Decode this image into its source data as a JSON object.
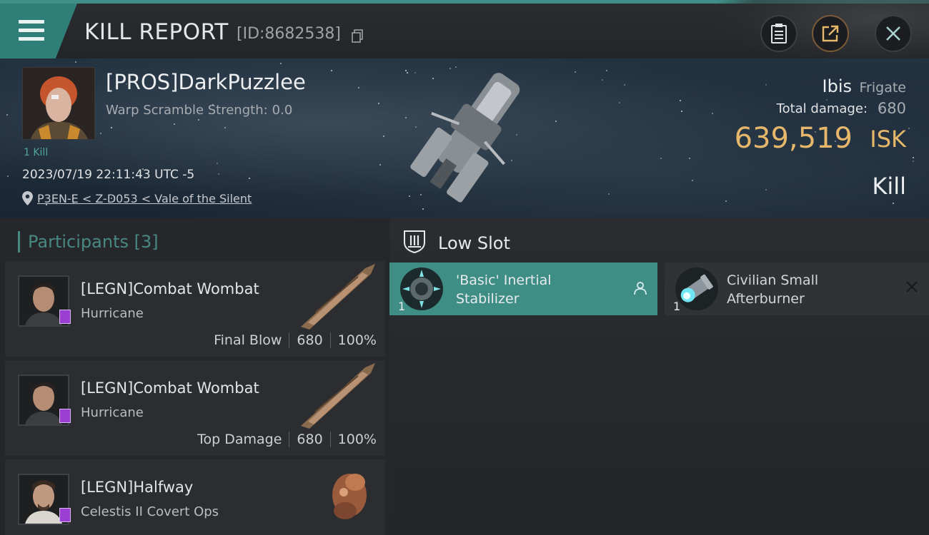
{
  "header": {
    "title": "KILL REPORT",
    "kill_id": "[ID:8682538]"
  },
  "victim": {
    "name": "[PROS]DarkPuzzlee",
    "warp_label": "Warp Scramble Strength:",
    "warp_value": "0.0",
    "kill_count": "1 Kill",
    "timestamp": "2023/07/19 22:11:43 UTC -5",
    "location": "P3EN-E < Z-D053 < Vale of the Silent",
    "ship_name": "Ibis",
    "ship_class": "Frigate",
    "damage_label": "Total damage:",
    "damage_value": "680",
    "isk_value": "639,519",
    "isk_unit": "ISK",
    "result": "Kill"
  },
  "participants": {
    "label": "Participants",
    "count": "[3]",
    "items": [
      {
        "name": "[LEGN]Combat Wombat",
        "ship": "Hurricane",
        "role": "Final Blow",
        "damage": "680",
        "percent": "100%"
      },
      {
        "name": "[LEGN]Combat Wombat",
        "ship": "Hurricane",
        "role": "Top Damage",
        "damage": "680",
        "percent": "100%"
      },
      {
        "name": "[LEGN]Halfway",
        "ship": "Celestis II Covert Ops"
      }
    ]
  },
  "low_slot": {
    "title": "Low Slot",
    "modules": [
      {
        "name_line1": "'Basic' Inertial",
        "name_line2": "Stabilizer",
        "qty": "1"
      },
      {
        "name_line1": "Civilian Small",
        "name_line2": "Afterburner",
        "qty": "1"
      }
    ]
  },
  "colors": {
    "accent": "#3e8e86",
    "isk": "#e6b76b",
    "badge": "#9a3fd1"
  }
}
